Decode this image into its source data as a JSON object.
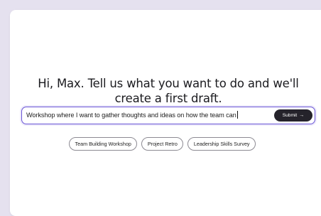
{
  "headline": {
    "line1": "Hi, Max. Tell us what you want to do and we'll",
    "line2": "create a first draft."
  },
  "prompt": {
    "value": "Workshop where I want to gather thoughts and ideas on how the team can",
    "submit_label": "Submit",
    "submit_icon": "arrow-right-icon"
  },
  "suggestions": [
    {
      "label": "Team Building Workshop"
    },
    {
      "label": "Project Retro"
    },
    {
      "label": "Leadership Skills Survey"
    }
  ],
  "colors": {
    "background": "#e5e1ef",
    "accent": "#6a55d6",
    "button": "#25232b"
  }
}
